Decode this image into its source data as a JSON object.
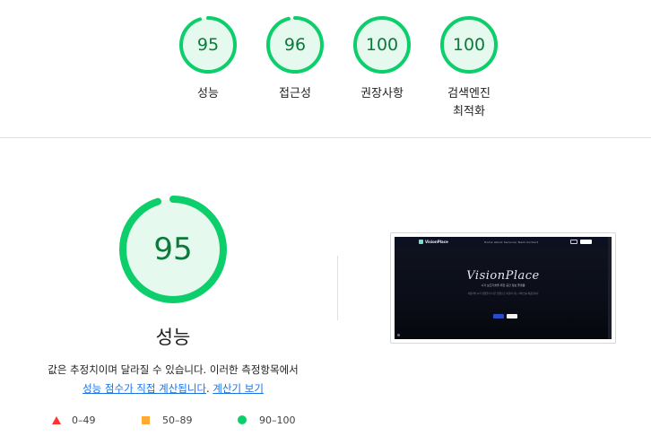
{
  "colors": {
    "pass_green": "#0cce6b",
    "pass_text": "#0c7a3a",
    "pass_fill": "#e6f9ee",
    "average_orange": "#ffaa33",
    "fail_red": "#ff3333",
    "link_blue": "#1a73e8"
  },
  "top_scores": [
    {
      "score": "95",
      "label": "성능"
    },
    {
      "score": "96",
      "label": "접근성"
    },
    {
      "score": "100",
      "label": "권장사항"
    },
    {
      "score": "100",
      "label": "검색엔진",
      "label2": "최적화"
    }
  ],
  "performance": {
    "score": "95",
    "title": "성능",
    "description": "값은 추정치이며 달라질 수 있습니다. 이러한 측정항목에서",
    "link_calc": "성능 점수가 직접 계산됩니다",
    "separator": ". ",
    "link_calculator": "계산기 보기"
  },
  "legend": [
    {
      "icon": "triangle-icon",
      "range": "0–49"
    },
    {
      "icon": "square-icon",
      "range": "50–89"
    },
    {
      "icon": "circle-icon",
      "range": "90–100"
    }
  ],
  "screenshot": {
    "logo": "VisionPlace",
    "menu": "Home  About  Services  Team  Contact",
    "hero_title": "VisionPlace",
    "hero_sub": "시각 보조기술을 위한 공간 정보 플랫폼",
    "hero_text": "사용자의 시각 경험을 더 나은 방향으로 이끌어 가는 서비스를 제공합니다"
  }
}
